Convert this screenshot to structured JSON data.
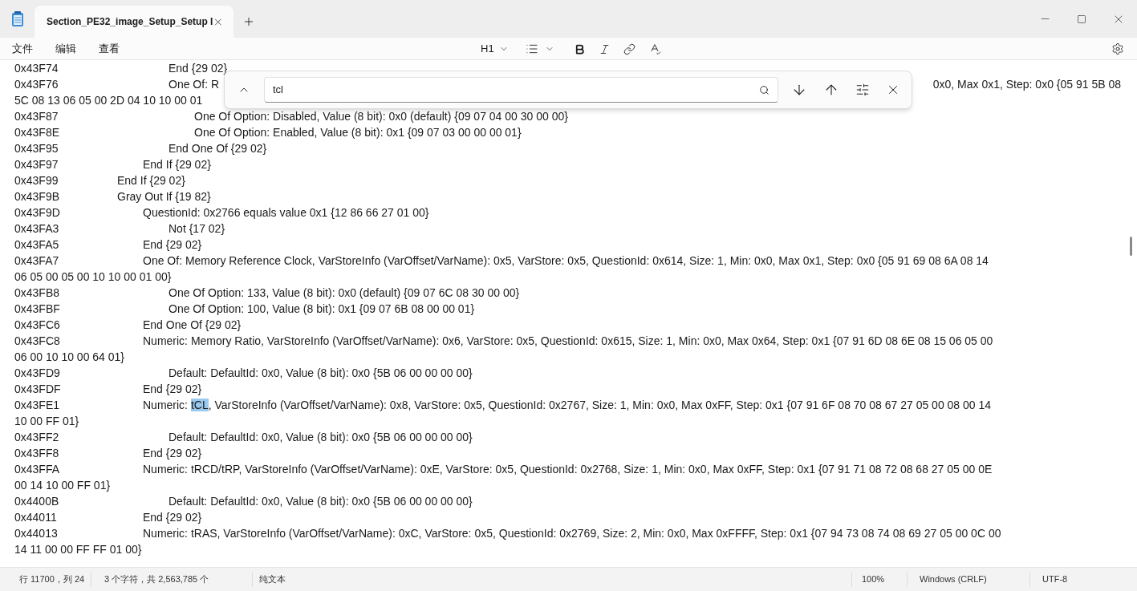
{
  "window": {
    "tab_title": "Section_PE32_image_Setup_Setup I"
  },
  "menu": [
    "文件",
    "编辑",
    "查看"
  ],
  "toolbar": {
    "heading": "H1"
  },
  "find": {
    "value": "tcl"
  },
  "lines": [
    {
      "kind": "text",
      "segments": [
        {
          "text": "0x43F74\t\t\t\t\tEnd {29 02}",
          "selected": false
        }
      ]
    },
    {
      "kind": "split",
      "left": "0x43F76\t\t\t\t\tOne Of: R",
      "right": "0x0, Max 0x1, Step: 0x0 {05 91 5B 08"
    },
    {
      "kind": "text",
      "segments": [
        {
          "text": "5C 08 13 06 05 00 2D 04 10 10 00 01",
          "selected": false
        }
      ]
    },
    {
      "kind": "text",
      "segments": [
        {
          "text": "0x43F87\t\t\t\t\t\tOne Of Option: Disabled, Value (8 bit): 0x0 (default) {09 07 04 00 30 00 00}",
          "selected": false
        }
      ]
    },
    {
      "kind": "text",
      "segments": [
        {
          "text": "0x43F8E\t\t\t\t\t\tOne Of Option: Enabled, Value (8 bit): 0x1 {09 07 03 00 00 00 01}",
          "selected": false
        }
      ]
    },
    {
      "kind": "text",
      "segments": [
        {
          "text": "0x43F95\t\t\t\t\tEnd One Of {29 02}",
          "selected": false
        }
      ]
    },
    {
      "kind": "text",
      "segments": [
        {
          "text": "0x43F97\t\t\t\tEnd If {29 02}",
          "selected": false
        }
      ]
    },
    {
      "kind": "text",
      "segments": [
        {
          "text": "0x43F99\t\t\tEnd If {29 02}",
          "selected": false
        }
      ]
    },
    {
      "kind": "text",
      "segments": [
        {
          "text": "0x43F9B\t\t\tGray Out If {19 82}",
          "selected": false
        }
      ]
    },
    {
      "kind": "text",
      "segments": [
        {
          "text": "0x43F9D\t\t\t\tQuestionId: 0x2766 equals value 0x1 {12 86 66 27 01 00}",
          "selected": false
        }
      ]
    },
    {
      "kind": "text",
      "segments": [
        {
          "text": "0x43FA3\t\t\t\t\tNot {17 02}",
          "selected": false
        }
      ]
    },
    {
      "kind": "text",
      "segments": [
        {
          "text": "0x43FA5\t\t\t\tEnd {29 02}",
          "selected": false
        }
      ]
    },
    {
      "kind": "text",
      "segments": [
        {
          "text": "0x43FA7\t\t\t\tOne Of: Memory Reference Clock, VarStoreInfo (VarOffset/VarName): 0x5, VarStore: 0x5, QuestionId: 0x614, Size: 1, Min: 0x0, Max 0x1, Step: 0x0 {05 91 69 08 6A 08 14",
          "selected": false
        }
      ]
    },
    {
      "kind": "text",
      "segments": [
        {
          "text": "06 05 00 05 00 10 10 00 01 00}",
          "selected": false
        }
      ]
    },
    {
      "kind": "text",
      "segments": [
        {
          "text": "0x43FB8\t\t\t\t\tOne Of Option: 133, Value (8 bit): 0x0 (default) {09 07 6C 08 30 00 00}",
          "selected": false
        }
      ]
    },
    {
      "kind": "text",
      "segments": [
        {
          "text": "0x43FBF\t\t\t\t\tOne Of Option: 100, Value (8 bit): 0x1 {09 07 6B 08 00 00 01}",
          "selected": false
        }
      ]
    },
    {
      "kind": "text",
      "segments": [
        {
          "text": "0x43FC6\t\t\t\tEnd One Of {29 02}",
          "selected": false
        }
      ]
    },
    {
      "kind": "text",
      "segments": [
        {
          "text": "0x43FC8\t\t\t\tNumeric: Memory Ratio, VarStoreInfo (VarOffset/VarName): 0x6, VarStore: 0x5, QuestionId: 0x615, Size: 1, Min: 0x0, Max 0x64, Step: 0x1 {07 91 6D 08 6E 08 15 06 05 00",
          "selected": false
        }
      ]
    },
    {
      "kind": "text",
      "segments": [
        {
          "text": "06 00 10 10 00 64 01}",
          "selected": false
        }
      ]
    },
    {
      "kind": "text",
      "segments": [
        {
          "text": "0x43FD9\t\t\t\t\tDefault: DefaultId: 0x0, Value (8 bit): 0x0 {5B 06 00 00 00 00}",
          "selected": false
        }
      ]
    },
    {
      "kind": "text",
      "segments": [
        {
          "text": "0x43FDF\t\t\t\tEnd {29 02}",
          "selected": false
        }
      ]
    },
    {
      "kind": "text",
      "segments": [
        {
          "text": "0x43FE1\t\t\t\tNumeric: ",
          "selected": false
        },
        {
          "text": "tCL",
          "selected": true
        },
        {
          "text": ", VarStoreInfo (VarOffset/VarName): 0x8, VarStore: 0x5, QuestionId: 0x2767, Size: 1, Min: 0x0, Max 0xFF, Step: 0x1 {07 91 6F 08 70 08 67 27 05 00 08 00 14",
          "selected": false
        }
      ]
    },
    {
      "kind": "text",
      "segments": [
        {
          "text": "10 00 FF 01}",
          "selected": false
        }
      ]
    },
    {
      "kind": "text",
      "segments": [
        {
          "text": "0x43FF2\t\t\t\t\tDefault: DefaultId: 0x0, Value (8 bit): 0x0 {5B 06 00 00 00 00}",
          "selected": false
        }
      ]
    },
    {
      "kind": "text",
      "segments": [
        {
          "text": "0x43FF8\t\t\t\tEnd {29 02}",
          "selected": false
        }
      ]
    },
    {
      "kind": "text",
      "segments": [
        {
          "text": "0x43FFA\t\t\t\tNumeric: tRCD/tRP, VarStoreInfo (VarOffset/VarName): 0xE, VarStore: 0x5, QuestionId: 0x2768, Size: 1, Min: 0x0, Max 0xFF, Step: 0x1 {07 91 71 08 72 08 68 27 05 00 0E",
          "selected": false
        }
      ]
    },
    {
      "kind": "text",
      "segments": [
        {
          "text": "00 14 10 00 FF 01}",
          "selected": false
        }
      ]
    },
    {
      "kind": "text",
      "segments": [
        {
          "text": "0x4400B\t\t\t\t\tDefault: DefaultId: 0x0, Value (8 bit): 0x0 {5B 06 00 00 00 00}",
          "selected": false
        }
      ]
    },
    {
      "kind": "text",
      "segments": [
        {
          "text": "0x44011\t\t\t\tEnd {29 02}",
          "selected": false
        }
      ]
    },
    {
      "kind": "text",
      "segments": [
        {
          "text": "0x44013\t\t\t\tNumeric: tRAS, VarStoreInfo (VarOffset/VarName): 0xC, VarStore: 0x5, QuestionId: 0x2769, Size: 2, Min: 0x0, Max 0xFFFF, Step: 0x1 {07 94 73 08 74 08 69 27 05 00 0C 00",
          "selected": false
        }
      ]
    },
    {
      "kind": "text",
      "segments": [
        {
          "text": "14 11 00 00 FF FF 01 00}",
          "selected": false
        }
      ]
    }
  ],
  "status_bar": {
    "position": "行 11700，列 24",
    "selection": "3 个字符，共 2,563,785 个",
    "format": "纯文本",
    "zoom": "100%",
    "line_ending": "Windows (CRLF)",
    "encoding": "UTF-8"
  }
}
